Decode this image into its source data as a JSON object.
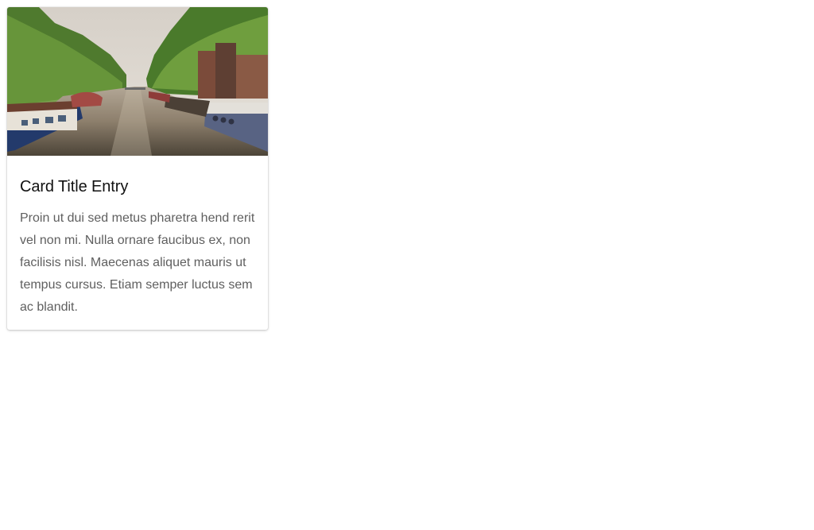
{
  "card": {
    "image": {
      "icon": "canal-photo",
      "description_colors": {
        "sky": "#d9d3cb",
        "trees": "#5f8a3a",
        "water": "#8a7c6c"
      }
    },
    "title": "Card Title Entry",
    "text": "Proin ut dui sed metus pharetra hend rerit vel non mi. Nulla ornare faucibus ex, non facilisis nisl. Maecenas aliquet mauris ut tempus cursus. Etiam semper luctus sem ac blandit."
  },
  "colors": {
    "title": "#111111",
    "text": "#5f5f5f",
    "card_background": "#ffffff",
    "page_background": "#ffffff"
  }
}
